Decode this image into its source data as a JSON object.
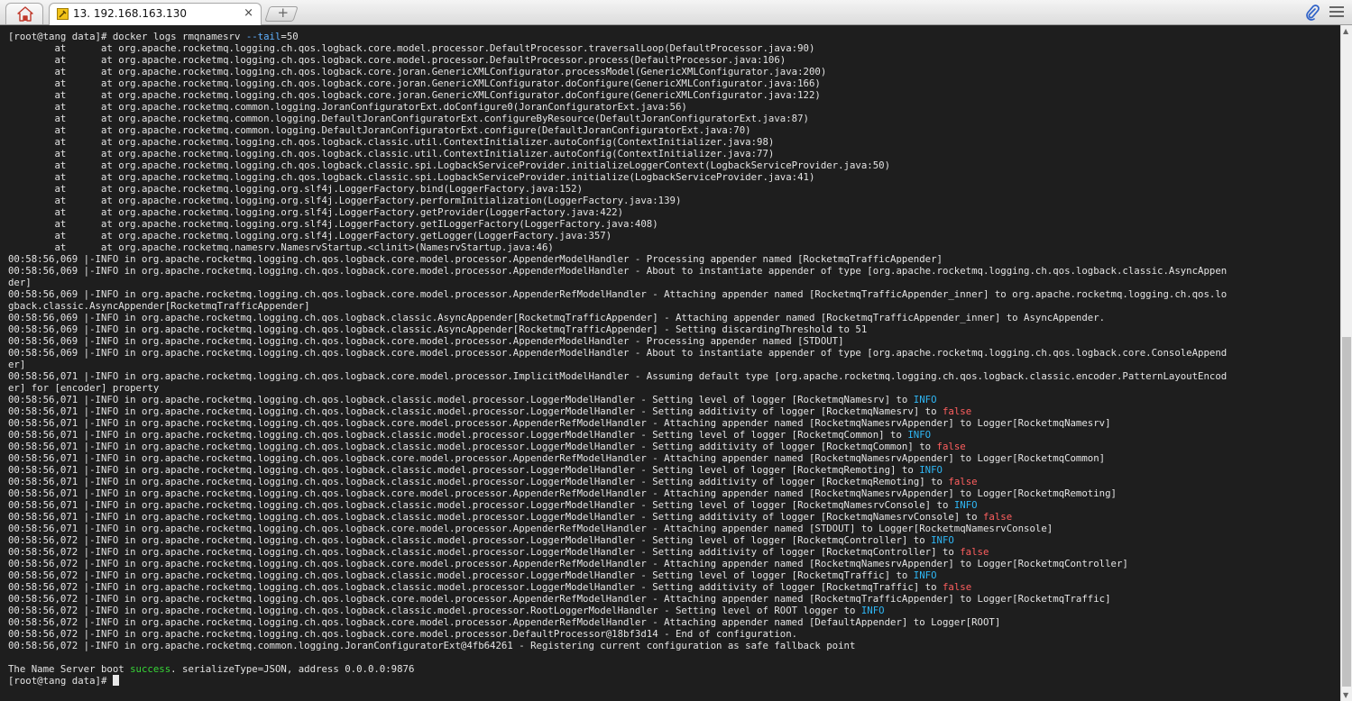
{
  "tabs": {
    "home_icon": "home-icon",
    "session": {
      "title": "13. 192.168.163.130",
      "icon": "ssh-session-icon",
      "close_label": "×"
    },
    "new_tab_label": "+"
  },
  "toolbar": {
    "attach_icon": "paperclip-icon",
    "menu_icon": "hamburger-menu-icon"
  },
  "colors": {
    "terminal_bg": "#1e1e1e",
    "text": "#e4e4e4",
    "info": "#2fb7f5",
    "false": "#ff5f5f",
    "success": "#37d637"
  },
  "terminal": {
    "lines": [
      [
        {
          "t": "[root@tang data]# docker logs rmqnamesrv "
        },
        {
          "t": "--tail",
          "c": "opt"
        },
        {
          "t": "=50"
        }
      ],
      [
        {
          "t": "        at      at org.apache.rocketmq.logging.ch.qos.logback.core.model.processor.DefaultProcessor.traversalLoop(DefaultProcessor.java:90)"
        }
      ],
      [
        {
          "t": "        at      at org.apache.rocketmq.logging.ch.qos.logback.core.model.processor.DefaultProcessor.process(DefaultProcessor.java:106)"
        }
      ],
      [
        {
          "t": "        at      at org.apache.rocketmq.logging.ch.qos.logback.core.joran.GenericXMLConfigurator.processModel(GenericXMLConfigurator.java:200)"
        }
      ],
      [
        {
          "t": "        at      at org.apache.rocketmq.logging.ch.qos.logback.core.joran.GenericXMLConfigurator.doConfigure(GenericXMLConfigurator.java:166)"
        }
      ],
      [
        {
          "t": "        at      at org.apache.rocketmq.logging.ch.qos.logback.core.joran.GenericXMLConfigurator.doConfigure(GenericXMLConfigurator.java:122)"
        }
      ],
      [
        {
          "t": "        at      at org.apache.rocketmq.common.logging.JoranConfiguratorExt.doConfigure0(JoranConfiguratorExt.java:56)"
        }
      ],
      [
        {
          "t": "        at      at org.apache.rocketmq.common.logging.DefaultJoranConfiguratorExt.configureByResource(DefaultJoranConfiguratorExt.java:87)"
        }
      ],
      [
        {
          "t": "        at      at org.apache.rocketmq.common.logging.DefaultJoranConfiguratorExt.configure(DefaultJoranConfiguratorExt.java:70)"
        }
      ],
      [
        {
          "t": "        at      at org.apache.rocketmq.logging.ch.qos.logback.classic.util.ContextInitializer.autoConfig(ContextInitializer.java:98)"
        }
      ],
      [
        {
          "t": "        at      at org.apache.rocketmq.logging.ch.qos.logback.classic.util.ContextInitializer.autoConfig(ContextInitializer.java:77)"
        }
      ],
      [
        {
          "t": "        at      at org.apache.rocketmq.logging.ch.qos.logback.classic.spi.LogbackServiceProvider.initializeLoggerContext(LogbackServiceProvider.java:50)"
        }
      ],
      [
        {
          "t": "        at      at org.apache.rocketmq.logging.ch.qos.logback.classic.spi.LogbackServiceProvider.initialize(LogbackServiceProvider.java:41)"
        }
      ],
      [
        {
          "t": "        at      at org.apache.rocketmq.logging.org.slf4j.LoggerFactory.bind(LoggerFactory.java:152)"
        }
      ],
      [
        {
          "t": "        at      at org.apache.rocketmq.logging.org.slf4j.LoggerFactory.performInitialization(LoggerFactory.java:139)"
        }
      ],
      [
        {
          "t": "        at      at org.apache.rocketmq.logging.org.slf4j.LoggerFactory.getProvider(LoggerFactory.java:422)"
        }
      ],
      [
        {
          "t": "        at      at org.apache.rocketmq.logging.org.slf4j.LoggerFactory.getILoggerFactory(LoggerFactory.java:408)"
        }
      ],
      [
        {
          "t": "        at      at org.apache.rocketmq.logging.org.slf4j.LoggerFactory.getLogger(LoggerFactory.java:357)"
        }
      ],
      [
        {
          "t": "        at      at org.apache.rocketmq.namesrv.NamesrvStartup.<clinit>(NamesrvStartup.java:46)"
        }
      ],
      [
        {
          "t": "00:58:56,069 |-INFO in org.apache.rocketmq.logging.ch.qos.logback.core.model.processor.AppenderModelHandler - Processing appender named [RocketmqTrafficAppender]"
        }
      ],
      [
        {
          "t": "00:58:56,069 |-INFO in org.apache.rocketmq.logging.ch.qos.logback.core.model.processor.AppenderModelHandler - About to instantiate appender of type [org.apache.rocketmq.logging.ch.qos.logback.classic.AsyncAppen"
        }
      ],
      [
        {
          "t": "der]"
        }
      ],
      [
        {
          "t": "00:58:56,069 |-INFO in org.apache.rocketmq.logging.ch.qos.logback.core.model.processor.AppenderRefModelHandler - Attaching appender named [RocketmqTrafficAppender_inner] to org.apache.rocketmq.logging.ch.qos.lo"
        }
      ],
      [
        {
          "t": "gback.classic.AsyncAppender[RocketmqTrafficAppender]"
        }
      ],
      [
        {
          "t": "00:58:56,069 |-INFO in org.apache.rocketmq.logging.ch.qos.logback.classic.AsyncAppender[RocketmqTrafficAppender] - Attaching appender named [RocketmqTrafficAppender_inner] to AsyncAppender."
        }
      ],
      [
        {
          "t": "00:58:56,069 |-INFO in org.apache.rocketmq.logging.ch.qos.logback.classic.AsyncAppender[RocketmqTrafficAppender] - Setting discardingThreshold to 51"
        }
      ],
      [
        {
          "t": "00:58:56,069 |-INFO in org.apache.rocketmq.logging.ch.qos.logback.core.model.processor.AppenderModelHandler - Processing appender named [STDOUT]"
        }
      ],
      [
        {
          "t": "00:58:56,069 |-INFO in org.apache.rocketmq.logging.ch.qos.logback.core.model.processor.AppenderModelHandler - About to instantiate appender of type [org.apache.rocketmq.logging.ch.qos.logback.core.ConsoleAppend"
        }
      ],
      [
        {
          "t": "er]"
        }
      ],
      [
        {
          "t": "00:58:56,071 |-INFO in org.apache.rocketmq.logging.ch.qos.logback.core.model.processor.ImplicitModelHandler - Assuming default type [org.apache.rocketmq.logging.ch.qos.logback.classic.encoder.PatternLayoutEncod"
        }
      ],
      [
        {
          "t": "er] for [encoder] property"
        }
      ],
      [
        {
          "t": "00:58:56,071 |-INFO in org.apache.rocketmq.logging.ch.qos.logback.classic.model.processor.LoggerModelHandler - Setting level of logger [RocketmqNamesrv] to "
        },
        {
          "t": "INFO",
          "c": "info"
        }
      ],
      [
        {
          "t": "00:58:56,071 |-INFO in org.apache.rocketmq.logging.ch.qos.logback.classic.model.processor.LoggerModelHandler - Setting additivity of logger [RocketmqNamesrv] to "
        },
        {
          "t": "false",
          "c": "false"
        }
      ],
      [
        {
          "t": "00:58:56,071 |-INFO in org.apache.rocketmq.logging.ch.qos.logback.core.model.processor.AppenderRefModelHandler - Attaching appender named [RocketmqNamesrvAppender] to Logger[RocketmqNamesrv]"
        }
      ],
      [
        {
          "t": "00:58:56,071 |-INFO in org.apache.rocketmq.logging.ch.qos.logback.classic.model.processor.LoggerModelHandler - Setting level of logger [RocketmqCommon] to "
        },
        {
          "t": "INFO",
          "c": "info"
        }
      ],
      [
        {
          "t": "00:58:56,071 |-INFO in org.apache.rocketmq.logging.ch.qos.logback.classic.model.processor.LoggerModelHandler - Setting additivity of logger [RocketmqCommon] to "
        },
        {
          "t": "false",
          "c": "false"
        }
      ],
      [
        {
          "t": "00:58:56,071 |-INFO in org.apache.rocketmq.logging.ch.qos.logback.core.model.processor.AppenderRefModelHandler - Attaching appender named [RocketmqNamesrvAppender] to Logger[RocketmqCommon]"
        }
      ],
      [
        {
          "t": "00:58:56,071 |-INFO in org.apache.rocketmq.logging.ch.qos.logback.classic.model.processor.LoggerModelHandler - Setting level of logger [RocketmqRemoting] to "
        },
        {
          "t": "INFO",
          "c": "info"
        }
      ],
      [
        {
          "t": "00:58:56,071 |-INFO in org.apache.rocketmq.logging.ch.qos.logback.classic.model.processor.LoggerModelHandler - Setting additivity of logger [RocketmqRemoting] to "
        },
        {
          "t": "false",
          "c": "false"
        }
      ],
      [
        {
          "t": "00:58:56,071 |-INFO in org.apache.rocketmq.logging.ch.qos.logback.core.model.processor.AppenderRefModelHandler - Attaching appender named [RocketmqNamesrvAppender] to Logger[RocketmqRemoting]"
        }
      ],
      [
        {
          "t": "00:58:56,071 |-INFO in org.apache.rocketmq.logging.ch.qos.logback.classic.model.processor.LoggerModelHandler - Setting level of logger [RocketmqNamesrvConsole] to "
        },
        {
          "t": "INFO",
          "c": "info"
        }
      ],
      [
        {
          "t": "00:58:56,071 |-INFO in org.apache.rocketmq.logging.ch.qos.logback.classic.model.processor.LoggerModelHandler - Setting additivity of logger [RocketmqNamesrvConsole] to "
        },
        {
          "t": "false",
          "c": "false"
        }
      ],
      [
        {
          "t": "00:58:56,071 |-INFO in org.apache.rocketmq.logging.ch.qos.logback.core.model.processor.AppenderRefModelHandler - Attaching appender named [STDOUT] to Logger[RocketmqNamesrvConsole]"
        }
      ],
      [
        {
          "t": "00:58:56,072 |-INFO in org.apache.rocketmq.logging.ch.qos.logback.classic.model.processor.LoggerModelHandler - Setting level of logger [RocketmqController] to "
        },
        {
          "t": "INFO",
          "c": "info"
        }
      ],
      [
        {
          "t": "00:58:56,072 |-INFO in org.apache.rocketmq.logging.ch.qos.logback.classic.model.processor.LoggerModelHandler - Setting additivity of logger [RocketmqController] to "
        },
        {
          "t": "false",
          "c": "false"
        }
      ],
      [
        {
          "t": "00:58:56,072 |-INFO in org.apache.rocketmq.logging.ch.qos.logback.core.model.processor.AppenderRefModelHandler - Attaching appender named [RocketmqNamesrvAppender] to Logger[RocketmqController]"
        }
      ],
      [
        {
          "t": "00:58:56,072 |-INFO in org.apache.rocketmq.logging.ch.qos.logback.classic.model.processor.LoggerModelHandler - Setting level of logger [RocketmqTraffic] to "
        },
        {
          "t": "INFO",
          "c": "info"
        }
      ],
      [
        {
          "t": "00:58:56,072 |-INFO in org.apache.rocketmq.logging.ch.qos.logback.classic.model.processor.LoggerModelHandler - Setting additivity of logger [RocketmqTraffic] to "
        },
        {
          "t": "false",
          "c": "false"
        }
      ],
      [
        {
          "t": "00:58:56,072 |-INFO in org.apache.rocketmq.logging.ch.qos.logback.core.model.processor.AppenderRefModelHandler - Attaching appender named [RocketmqTrafficAppender] to Logger[RocketmqTraffic]"
        }
      ],
      [
        {
          "t": "00:58:56,072 |-INFO in org.apache.rocketmq.logging.ch.qos.logback.classic.model.processor.RootLoggerModelHandler - Setting level of ROOT logger to "
        },
        {
          "t": "INFO",
          "c": "info"
        }
      ],
      [
        {
          "t": "00:58:56,072 |-INFO in org.apache.rocketmq.logging.ch.qos.logback.core.model.processor.AppenderRefModelHandler - Attaching appender named [DefaultAppender] to Logger[ROOT]"
        }
      ],
      [
        {
          "t": "00:58:56,072 |-INFO in org.apache.rocketmq.logging.ch.qos.logback.core.model.processor.DefaultProcessor@18bf3d14 - End of configuration."
        }
      ],
      [
        {
          "t": "00:58:56,072 |-INFO in org.apache.rocketmq.common.logging.JoranConfiguratorExt@4fb64261 - Registering current configuration as safe fallback point"
        }
      ],
      [
        {
          "t": ""
        }
      ],
      [
        {
          "t": "The Name Server boot "
        },
        {
          "t": "success",
          "c": "success"
        },
        {
          "t": ". serializeType=JSON, address 0.0.0.0:9876"
        }
      ],
      [
        {
          "t": "[root@tang data]# "
        },
        {
          "t": "",
          "cursor": true
        }
      ]
    ]
  }
}
